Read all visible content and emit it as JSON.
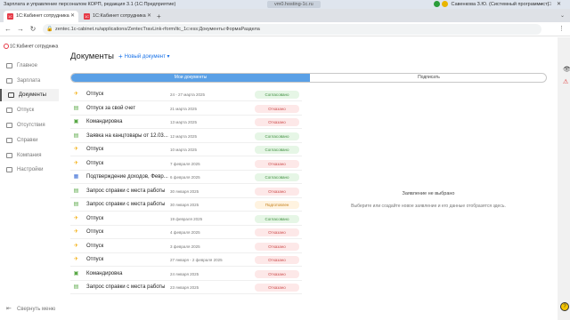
{
  "os": {
    "title": "Зарплата и управление персоналом КОРП, редакция 3.1  (1С:Предприятие)",
    "center_title": "vm0.hosting-1c.ru",
    "user": "Савенкова З.Ю. (Системный программист)"
  },
  "browser": {
    "tabs": [
      {
        "label": "1С:Кабинет сотрудника",
        "active": true
      },
      {
        "label": "1С:Кабинет сотрудника",
        "active": false
      }
    ],
    "url": "zentec.1c-cabinet.ru/applications/ZentecTravLink-rform/itc_1c:ess:Документы:ФормаРаздела"
  },
  "sidebar": {
    "brand": "1С:Кабинет сотрудника",
    "items": [
      {
        "label": "Главное",
        "icon": "home-icon"
      },
      {
        "label": "Зарплата",
        "icon": "wallet-icon"
      },
      {
        "label": "Документы",
        "icon": "documents-icon",
        "active": true
      },
      {
        "label": "Отпуск",
        "icon": "vacation-icon"
      },
      {
        "label": "Отсутствия",
        "icon": "absence-icon"
      },
      {
        "label": "Справки",
        "icon": "certificate-icon"
      },
      {
        "label": "Компания",
        "icon": "company-icon"
      },
      {
        "label": "Настройки",
        "icon": "settings-icon"
      }
    ],
    "collapse_label": "Свернуть меню"
  },
  "main": {
    "title": "Документы",
    "new_doc_label": "Новый документ",
    "tabs": [
      "Мои документы",
      "Подписать"
    ],
    "documents": [
      {
        "icon": "plane",
        "name": "Отпуск",
        "date": "24 - 27 марта 2025",
        "status": "Согласовано",
        "kind": "ok"
      },
      {
        "icon": "doc",
        "name": "Отпуск за свой счет",
        "date": "21 марта 2025",
        "status": "Отказано",
        "kind": "no"
      },
      {
        "icon": "case",
        "name": "Командировка",
        "date": "13 марта 2025",
        "status": "Отказано",
        "kind": "no"
      },
      {
        "icon": "doc",
        "name": "Заявка на канцтовары от 12.03....",
        "date": "12 марта 2025",
        "status": "Согласовано",
        "kind": "ok"
      },
      {
        "icon": "plane",
        "name": "Отпуск",
        "date": "10 марта 2025",
        "status": "Согласовано",
        "kind": "ok"
      },
      {
        "icon": "plane",
        "name": "Отпуск",
        "date": "7 февраля 2025",
        "status": "Отказано",
        "kind": "no"
      },
      {
        "icon": "cal",
        "name": "Подтверждение доходов, Февр...",
        "date": "6 февраля 2025",
        "status": "Согласовано",
        "kind": "ok"
      },
      {
        "icon": "doc",
        "name": "Запрос справки с места работы",
        "date": "30 января 2025",
        "status": "Отказано",
        "kind": "no"
      },
      {
        "icon": "doc",
        "name": "Запрос справки с места работы",
        "date": "30 января 2025",
        "status": "Подготовлен",
        "kind": "pend"
      },
      {
        "icon": "plane",
        "name": "Отпуск",
        "date": "19 февраля 2025",
        "status": "Согласовано",
        "kind": "ok"
      },
      {
        "icon": "plane",
        "name": "Отпуск",
        "date": "4 февраля 2025",
        "status": "Отказано",
        "kind": "no"
      },
      {
        "icon": "plane",
        "name": "Отпуск",
        "date": "3 февраля 2025",
        "status": "Отказано",
        "kind": "no"
      },
      {
        "icon": "plane",
        "name": "Отпуск",
        "date": "27 января - 2 февраля 2025",
        "status": "Отказано",
        "kind": "no"
      },
      {
        "icon": "case",
        "name": "Командировка",
        "date": "24 января 2025",
        "status": "Отказано",
        "kind": "no"
      },
      {
        "icon": "doc",
        "name": "Запрос справки с места работы",
        "date": "23 января 2025",
        "status": "Отказано",
        "kind": "no"
      }
    ],
    "empty_title": "Заявление не выбрано",
    "empty_text": "Выберите или создайте новое заявление и его данные отобразятся здесь."
  }
}
